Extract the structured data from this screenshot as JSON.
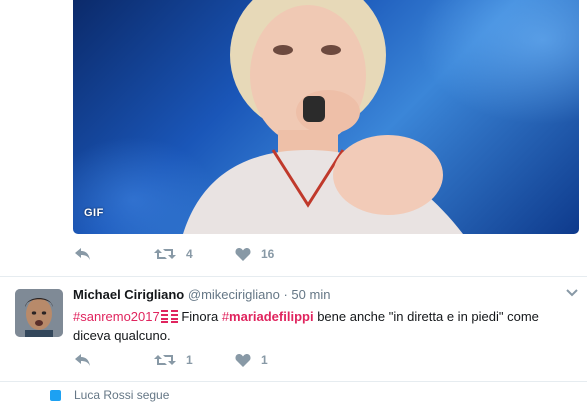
{
  "tweet1": {
    "media_badge": "GIF",
    "actions": {
      "reply": "",
      "retweet_count": "4",
      "like_count": "16"
    }
  },
  "tweet2": {
    "fullname": "Michael Cirigliano",
    "username": "@mikecirigliano",
    "separator": "·",
    "time": "50 min",
    "text_parts": {
      "hashtag1": "#sanremo2017",
      "t1": " Finora ",
      "hashtag2_hash": "#",
      "hashtag2_word": "mariadefilippi",
      "t2": " bene anche \"in diretta e in piedi\" come diceva qualcuno."
    },
    "actions": {
      "retweet_count": "1",
      "like_count": "1"
    }
  },
  "activity": {
    "text": "Luca Rossi segue"
  },
  "colors": {
    "hashtag": "#e0245e",
    "action_gray": "#8899a6",
    "divider": "#e6ecf0",
    "link_blue": "#1da1f2"
  },
  "icons": [
    "reply-icon",
    "retweet-icon",
    "heart-icon",
    "caret-down-icon",
    "flag-emoji-icon",
    "follow-icon"
  ]
}
